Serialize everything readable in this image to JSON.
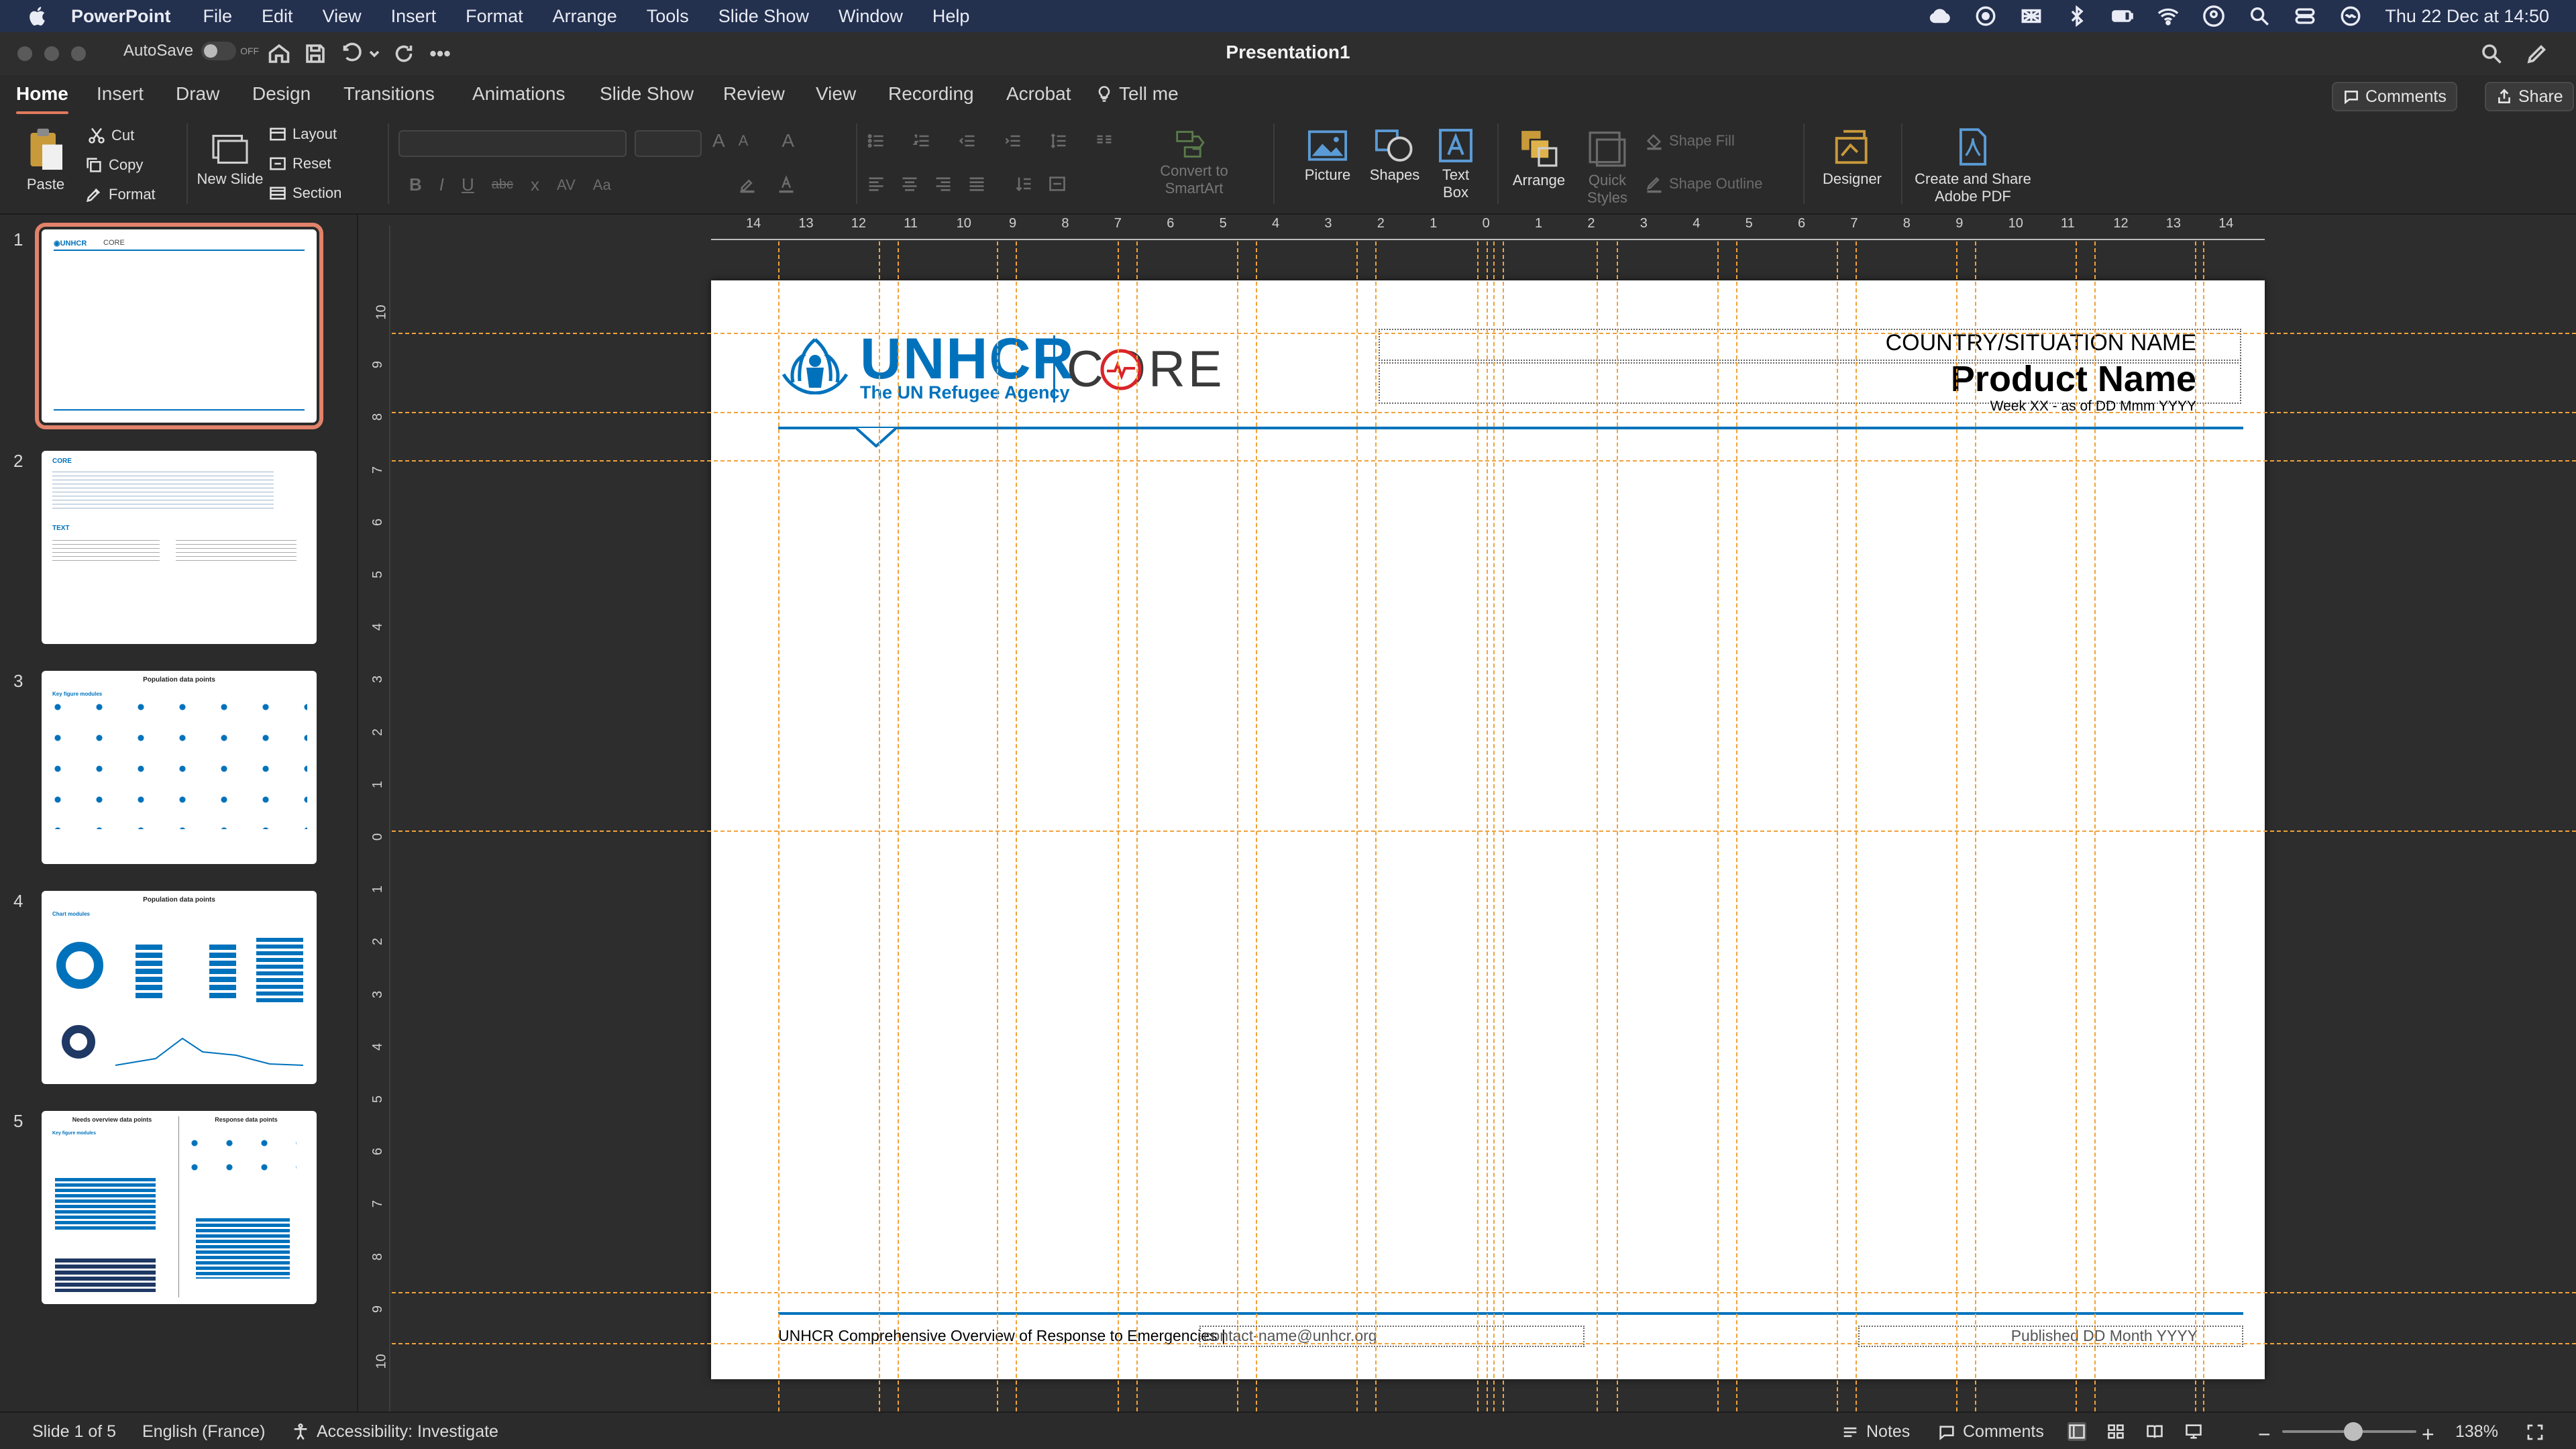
{
  "menubar": {
    "app_name": "PowerPoint",
    "items": [
      "File",
      "Edit",
      "View",
      "Insert",
      "Format",
      "Arrange",
      "Tools",
      "Slide Show",
      "Window",
      "Help"
    ],
    "clock": "Thu 22 Dec at 14:50"
  },
  "titlebar": {
    "autosave_label": "AutoSave",
    "autosave_state": "OFF",
    "document_title": "Presentation1"
  },
  "ribbon_tabs": {
    "items": [
      "Home",
      "Insert",
      "Draw",
      "Design",
      "Transitions",
      "Animations",
      "Slide Show",
      "Review",
      "View",
      "Recording",
      "Acrobat"
    ],
    "active": "Home",
    "tell_me": "Tell me",
    "comments_button": "Comments",
    "share_button": "Share"
  },
  "ribbon": {
    "paste": "Paste",
    "cut": "Cut",
    "copy": "Copy",
    "format": "Format",
    "new_slide": "New Slide",
    "layout": "Layout",
    "reset": "Reset",
    "section": "Section",
    "convert_to_smartart": "Convert to SmartArt",
    "picture": "Picture",
    "shapes": "Shapes",
    "text_box": "Text Box",
    "arrange": "Arrange",
    "quick_styles": "Quick Styles",
    "shape_fill": "Shape Fill",
    "shape_outline": "Shape Outline",
    "designer": "Designer",
    "create_share_pdf": "Create and Share Adobe PDF",
    "format_bold": "B",
    "format_italic": "I",
    "format_underline": "U",
    "format_strike": "abc",
    "format_sub": "x",
    "format_spacing": "AV",
    "format_case": "Aa"
  },
  "thumbnails": [
    {
      "number": "1",
      "title": "CORE",
      "selected": true
    },
    {
      "number": "2",
      "title": "CORE",
      "subtitle": "TEXT",
      "selected": false
    },
    {
      "number": "3",
      "title": "Population data points",
      "section": "Key figure modules",
      "selected": false
    },
    {
      "number": "4",
      "title": "Population data points",
      "section": "Chart modules",
      "selected": false
    },
    {
      "number": "5",
      "title": "Needs overview data points",
      "title_right": "Response data points",
      "section": "Key figure modules",
      "selected": false
    }
  ],
  "rulers": {
    "horizontal": [
      "14",
      "13",
      "12",
      "11",
      "10",
      "9",
      "8",
      "7",
      "6",
      "5",
      "4",
      "3",
      "2",
      "1",
      "0",
      "1",
      "2",
      "3",
      "4",
      "5",
      "6",
      "7",
      "8",
      "9",
      "10",
      "11",
      "12",
      "13",
      "14"
    ],
    "vertical": [
      "10",
      "9",
      "8",
      "7",
      "6",
      "5",
      "4",
      "3",
      "2",
      "1",
      "0",
      "1",
      "2",
      "3",
      "4",
      "5",
      "6",
      "7",
      "8",
      "9",
      "10"
    ]
  },
  "slide": {
    "logo_text": "UNHCR",
    "logo_tagline": "The UN Refugee Agency",
    "core_text": "CORE",
    "country": "COUNTRY/SITUATION NAME",
    "product_name": "Product Name",
    "week": "Week XX - as of DD Mmm YYYY",
    "footer_left": "UNHCR Comprehensive Overview of Response to Emergencies |",
    "footer_contact": "contact-name@unhcr.org",
    "footer_published": "Published DD Month YYYY",
    "brand_color": "#0072bc",
    "accent_color": "#d9252a"
  },
  "statusbar": {
    "slide_info": "Slide 1 of 5",
    "language": "English (France)",
    "accessibility": "Accessibility: Investigate",
    "notes": "Notes",
    "comments": "Comments",
    "zoom_minus": "−",
    "zoom_plus": "+",
    "zoom": "138%"
  }
}
